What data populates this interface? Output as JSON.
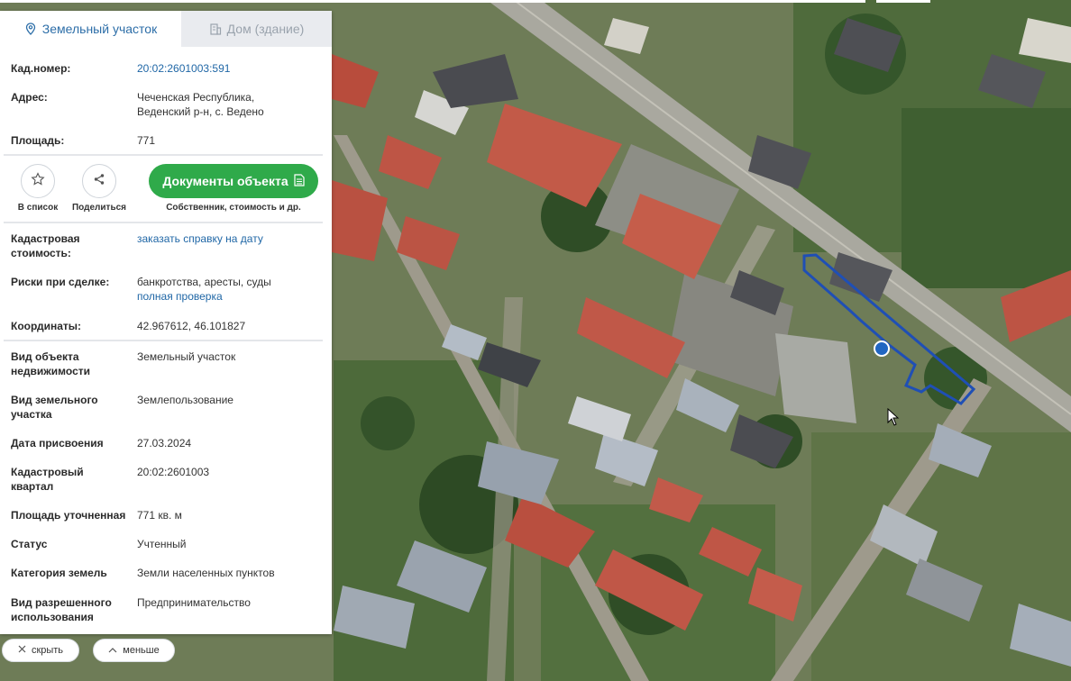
{
  "tabs": {
    "land_label": "Земельный участок",
    "building_label": "Дом (здание)"
  },
  "summary": {
    "cad_label": "Кад.номер:",
    "cad_value": "20:02:2601003:591",
    "address_label": "Адрес:",
    "address_line1": "Чеченская Республика,",
    "address_line2": "Веденский р-н, с. Ведено",
    "area_label": "Площадь:",
    "area_value": "771"
  },
  "actions": {
    "favorite_label": "В список",
    "share_label": "Поделиться",
    "docs_label": "Документы объекта",
    "docs_caption": "Собственник, стоимость и др."
  },
  "details": {
    "cad_cost_label1": "Кадастровая",
    "cad_cost_label2": "стоимость:",
    "cad_cost_link": "заказать справку на дату",
    "risks_label": "Риски при сделке:",
    "risks_value": "банкротства, аресты, суды",
    "risks_link": "полная проверка",
    "coords_label": "Координаты:",
    "coords_value": "42.967612, 46.101827"
  },
  "properties": [
    {
      "label1": "Вид объекта",
      "label2": "недвижимости",
      "value": "Земельный участок"
    },
    {
      "label1": "Вид земельного",
      "label2": "участка",
      "value": "Землепользование"
    },
    {
      "label1": "Дата присвоения",
      "label2": "",
      "value": "27.03.2024"
    },
    {
      "label1": "Кадастровый",
      "label2": "квартал",
      "value": "20:02:2601003"
    },
    {
      "label1": "Площадь уточненная",
      "label2": "",
      "value": "771 кв. м"
    },
    {
      "label1": "Статус",
      "label2": "",
      "value": "Учтенный"
    },
    {
      "label1": "Категория земель",
      "label2": "",
      "value": "Земли населенных пунктов"
    },
    {
      "label1": "Вид разрешенного",
      "label2": "использования",
      "value": "Предпринимательство"
    }
  ],
  "bottom": {
    "hide_label": "скрыть",
    "less_label": "меньше"
  },
  "colors": {
    "accent_blue": "#2d6ea8",
    "link_blue": "#2067a6",
    "docs_green": "#2faa4a",
    "parcel_outline": "#1f4fb5",
    "marker": "#2166c2"
  }
}
